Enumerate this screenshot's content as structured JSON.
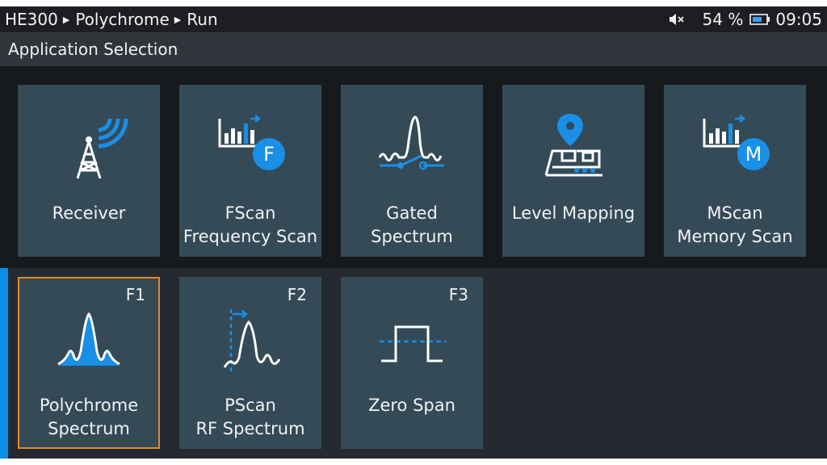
{
  "status": {
    "breadcrumb": [
      "HE300",
      "Polychrome",
      "Run"
    ],
    "battery": "54 %",
    "time": "09:05"
  },
  "title": "Application Selection",
  "apps": [
    {
      "name": "receiver",
      "lines": [
        "Receiver"
      ],
      "icon": "tower-icon"
    },
    {
      "name": "fscan",
      "lines": [
        "FScan",
        "Frequency Scan"
      ],
      "icon": "fscan-icon"
    },
    {
      "name": "gated-spectrum",
      "lines": [
        "Gated",
        "Spectrum"
      ],
      "icon": "gated-spectrum-icon"
    },
    {
      "name": "level-mapping",
      "lines": [
        "Level Mapping"
      ],
      "icon": "map-pin-icon"
    },
    {
      "name": "mscan",
      "lines": [
        "MScan",
        "Memory Scan"
      ],
      "icon": "mscan-icon"
    }
  ],
  "modes": [
    {
      "name": "polychrome-spectrum",
      "key": "F1",
      "lines": [
        "Polychrome",
        "Spectrum"
      ],
      "icon": "polychrome-spectrum-icon",
      "selected": true
    },
    {
      "name": "pscan",
      "key": "F2",
      "lines": [
        "PScan",
        "RF Spectrum"
      ],
      "icon": "pscan-icon",
      "selected": false
    },
    {
      "name": "zero-span",
      "key": "F3",
      "lines": [
        "Zero Span"
      ],
      "icon": "zero-span-icon",
      "selected": false
    }
  ],
  "colors": {
    "accent": "#0a8ee6",
    "selection": "#e08a2a",
    "tile": "#344a57"
  }
}
